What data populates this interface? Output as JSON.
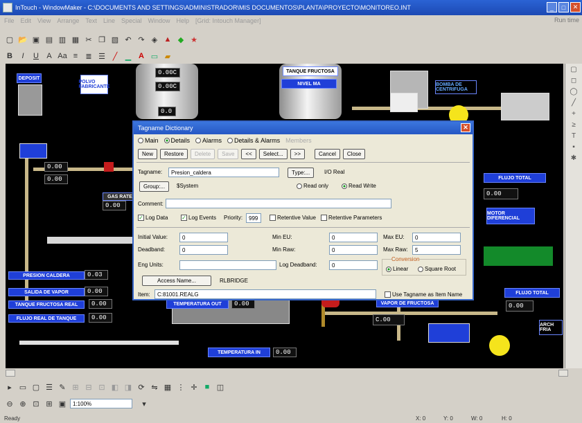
{
  "window": {
    "title": "InTouch - WindowMaker - C:\\DOCUMENTS AND SETTINGS\\ADMINISTRADOR\\MIS DOCUMENTOS\\PLANTA\\PROYECTO\\MONITOREO.INT"
  },
  "menu": {
    "items": [
      "File",
      "Edit",
      "View",
      "Arrange",
      "Text",
      "Line",
      "Special",
      "Window",
      "Help",
      "[Grid: Intouch Manager]"
    ],
    "extra": "Run time"
  },
  "toolbar1": {
    "icons": [
      "new-icon",
      "open-icon",
      "save-icon",
      "save-all-icon",
      "delete-icon",
      "print-icon",
      "cut-icon",
      "copy-icon",
      "paste-icon",
      "undo-icon",
      "redo-icon",
      "tag-icon",
      "script-icon",
      "animation-icon",
      "run-icon"
    ]
  },
  "toolbar2": {
    "icons": [
      "bold-icon",
      "italic-icon",
      "underline-icon",
      "font-icon",
      "font-size-icon",
      "align-left-icon",
      "align-center-icon",
      "align-right-icon",
      "line-icon",
      "fill-icon",
      "text-color-icon",
      "line-color-icon",
      "window-color-icon"
    ]
  },
  "canvas": {
    "labels": {
      "lbl_deposit": "DEPOSIT",
      "lbl_polvo": "POLVO FABRICANTE",
      "lbl_tanque": "TANQUE FRUCTOSA",
      "lbl_nivel": "NIVEL MA",
      "lbl_bomba": "BOMBA DE CENTRIFUGA",
      "lbl_flujo_total": "FLUJO TOTAL",
      "lbl_motor": "MOTOR DIFERENCIAL",
      "lbl_temp_out": "TEMPERATURA OUT",
      "lbl_temp_in": "TEMPERATURA IN",
      "lbl_presion": "PRESION CALDERA",
      "lbl_flujo_total2": "FLUJO TOTAL",
      "lbl_salida": "SALIDA DE VAPOR",
      "lbl_gas_rate": "GAS RATE",
      "lbl_tanque_real": "TANQUE FRUCTOSA REAL",
      "lbl_flujo_real": "FLUJO REAL DE TANQUE",
      "lbl_vapor_fruc": "VAPOR DE FRUCTOSA",
      "lbl_arch": "ARCH FRIA"
    },
    "values": {
      "v_top1": "0.00C",
      "v_top2": "0.00C",
      "v_center": "0.0",
      "v_left1": "0.00",
      "v_left2": "0.00",
      "v_bottom1": "0.03",
      "v_bottom2": "0.00",
      "v_bottom3": "0.00",
      "v_bottom4": "0.00",
      "v_temp_out": "0.00",
      "v_temp_in": "0.00",
      "v_right1": "0.00",
      "v_right2": "0.00",
      "v_c00": "C.00",
      "v_mid": "0.00"
    }
  },
  "dialog": {
    "title": "Tagname Dictionary",
    "radios": [
      "Main",
      "Details",
      "Alarms",
      "Details & Alarms",
      "Members"
    ],
    "selected_radio": "Details",
    "buttons": {
      "new": "New",
      "restore": "Restore",
      "delete": "Delete",
      "save": "Save",
      "prev": "<<",
      "select": "Select...",
      "next": ">>",
      "cancel": "Cancel",
      "close": "Close"
    },
    "tagname_label": "Tagname:",
    "tagname_value": "Presion_caldera",
    "type_button": "Type:...",
    "type_value": "I/O Real",
    "group_button": "Group:...",
    "group_value": "$System",
    "readonly_label": "Read only",
    "readwrite_label": "Read Write",
    "comment_label": "Comment:",
    "comment_value": "",
    "log_data": "Log Data",
    "log_events": "Log Events",
    "priority_label": "Priority:",
    "priority_value": "999",
    "retentive_value": "Retentive Value",
    "retentive_params": "Retentive Parameters",
    "initial_value_label": "Initial Value:",
    "initial_value": "0",
    "deadband_label": "Deadband:",
    "deadband_value": "0",
    "eng_units_label": "Eng Units:",
    "eng_units_value": "",
    "min_eu_label": "Min EU:",
    "min_eu_value": "0",
    "max_eu_label": "Max EU:",
    "max_eu_value": "0",
    "min_raw_label": "Min Raw:",
    "min_raw_value": "0",
    "max_raw_label": "Max Raw:",
    "max_raw_value": "5",
    "log_deadband_label": "Log Deadband:",
    "log_deadband_value": "0",
    "conversion_label": "Conversion",
    "linear_label": "Linear",
    "sqrt_label": "Square Root",
    "access_button": "Access Name...",
    "access_value": "RLBRIDGE",
    "use_tagname": "Use Tagname as Item Name",
    "item_label": "Item:",
    "item_value": "C:81001.REALG"
  },
  "bottom_toolbar": {
    "zoom": "1:100%"
  },
  "status": {
    "left": "Ready",
    "x": "X: 0",
    "y": "Y: 0",
    "w": "W: 0",
    "h": "H: 0"
  }
}
